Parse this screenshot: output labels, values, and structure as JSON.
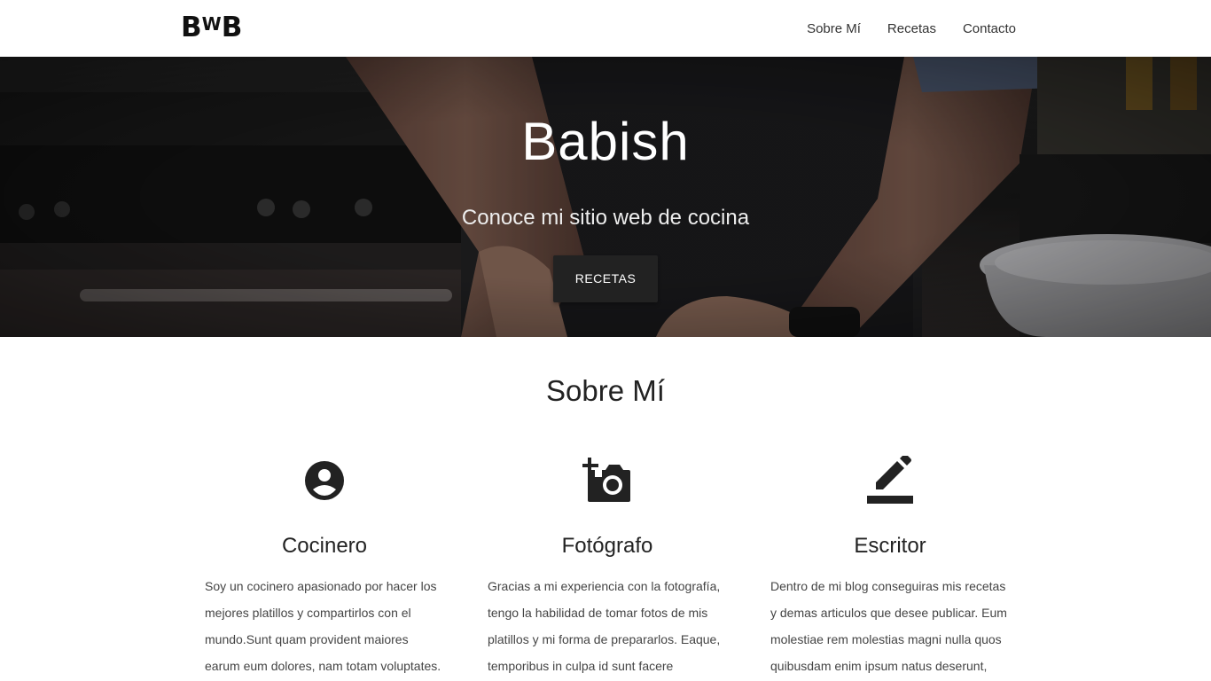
{
  "navbar": {
    "logo_b1": "B",
    "logo_w": "W",
    "logo_b2": "B",
    "links": [
      "Sobre Mí",
      "Recetas",
      "Contacto"
    ]
  },
  "hero": {
    "title": "Babish",
    "subtitle": "Conoce mi sitio web de cocina",
    "button_label": "RECETAS"
  },
  "about": {
    "title": "Sobre Mí",
    "cards": [
      {
        "icon": "account-circle-icon",
        "title": "Cocinero",
        "text": "Soy un cocinero apasionado por hacer los mejores platillos y compartirlos con el mundo.Sunt quam provident maiores earum eum dolores, nam totam voluptates."
      },
      {
        "icon": "add-a-photo-icon",
        "title": "Fotógrafo",
        "text": "Gracias a mi experiencia con la fotografía, tengo la habilidad de tomar fotos de mis platillos y mi forma de prepararlos. Eaque, temporibus in culpa id sunt facere repudiandae necessitatibus"
      },
      {
        "icon": "edit-pencil-icon",
        "title": "Escritor",
        "text": "Dentro de mi blog conseguiras mis recetas y demas articulos que desee publicar. Eum molestiae rem molestias magni nulla quos quibusdam enim ipsum natus deserunt, dolor impedit!"
      }
    ]
  },
  "colors": {
    "button_bg": "#222222",
    "text": "#222222",
    "hero_overlay": "#1c1c1e"
  }
}
